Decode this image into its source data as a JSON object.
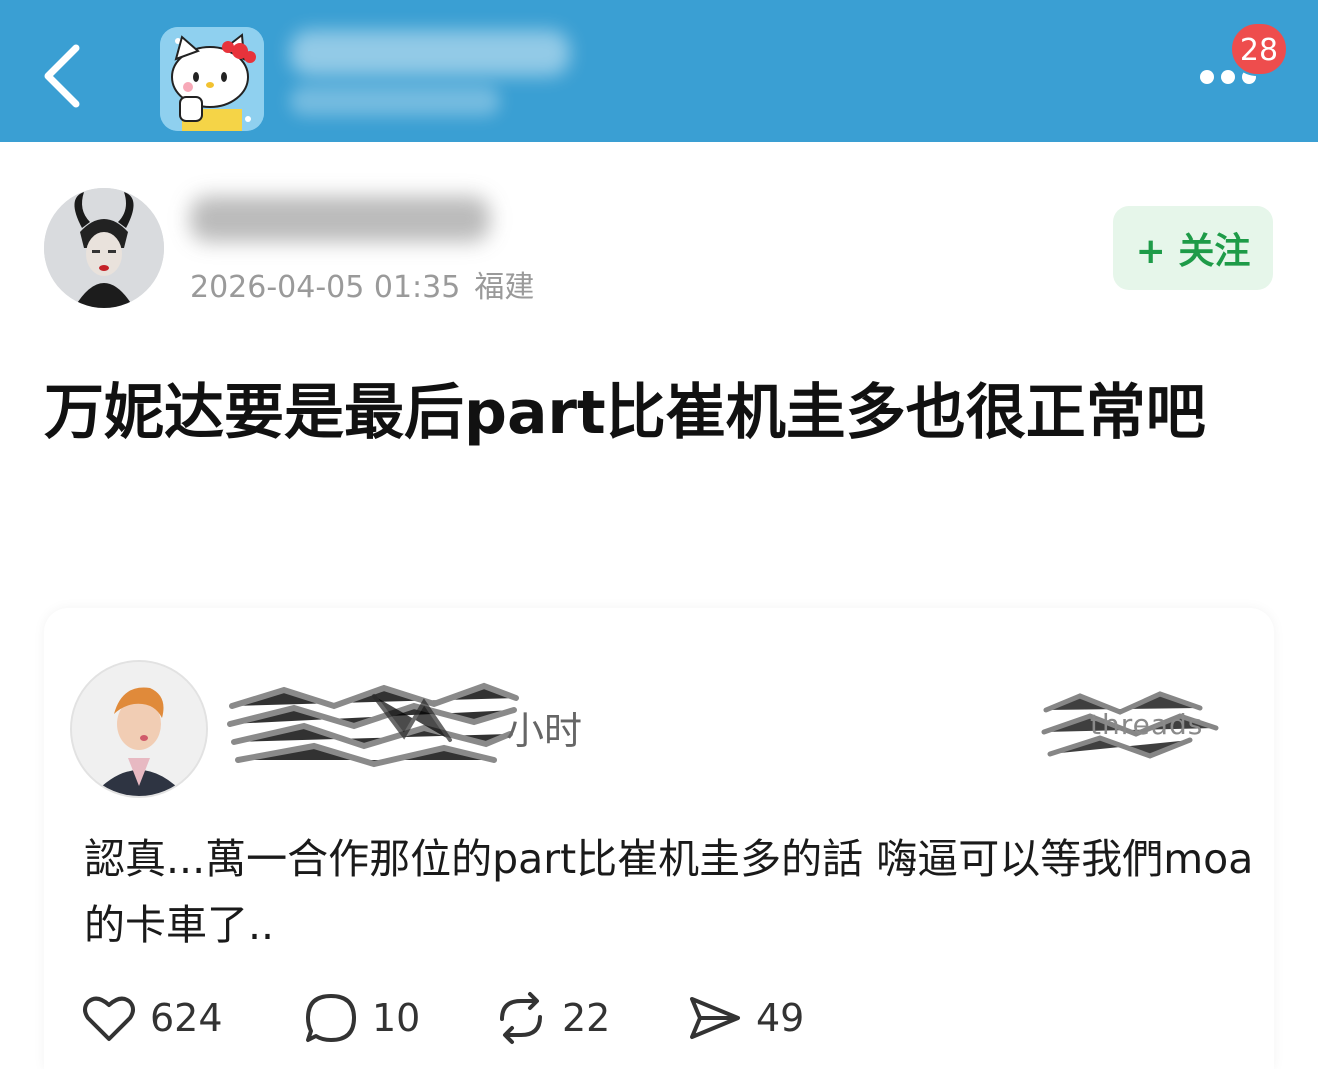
{
  "header": {
    "notification_count": "28",
    "group_avatar_icon": "hello-kitty-avatar"
  },
  "post": {
    "timestamp": "2026-04-05 01:35",
    "location": "福建",
    "follow_label": "+ 关注",
    "headline": "万妮达要是最后part比崔机圭多也很正常吧"
  },
  "quoted": {
    "time_suffix": "小时",
    "source": "threads",
    "text": "認真...萬一合作那位的part比崔机圭多的話 嗨逼可以等我們moa的卡車了..",
    "likes": "624",
    "comments": "10",
    "reposts": "22",
    "shares": "49"
  },
  "colors": {
    "header_bg": "#3a9fd3",
    "badge_bg": "#ee4d4d",
    "follow_bg": "#e6f6ea",
    "follow_text": "#1e9b48"
  }
}
